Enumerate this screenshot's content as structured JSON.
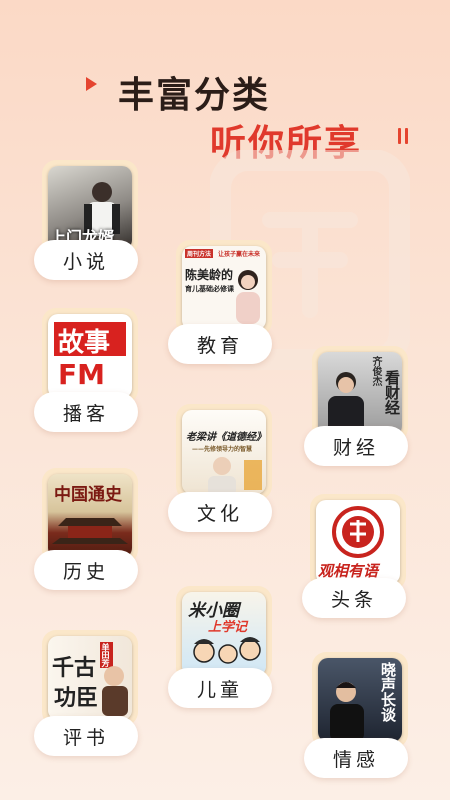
{
  "header": {
    "line1": "丰富分类",
    "line2": "听你所享"
  },
  "categories": [
    {
      "label": "小说",
      "cover_title": "上门龙婿",
      "icon": "novel-cover"
    },
    {
      "label": "教育",
      "cover_title": "陈美龄的育儿基础必修课",
      "cover_line1": "陈美龄的",
      "cover_line2": "育儿基础必修课",
      "cover_tag1": "周刊方法",
      "cover_tag2": "让孩子赢在未来",
      "icon": "education-cover"
    },
    {
      "label": "播客",
      "cover_title": "故事FM",
      "cover_line1": "故事",
      "cover_line2": "FM",
      "icon": "podcast-cover"
    },
    {
      "label": "财经",
      "cover_title": "齐俊杰看财经",
      "cover_line1": "齐俊杰",
      "cover_line2": "看财经",
      "icon": "finance-cover"
    },
    {
      "label": "文化",
      "cover_title": "老梁讲《道德经》",
      "cover_subtitle": "——先修领导力的智慧",
      "icon": "culture-cover"
    },
    {
      "label": "历史",
      "cover_title": "中国通史",
      "icon": "history-cover"
    },
    {
      "label": "头条",
      "cover_title": "观相有语",
      "icon": "headline-cover"
    },
    {
      "label": "儿童",
      "cover_title": "米小圈上学记",
      "cover_line1": "米小圈",
      "cover_line2": "上学记",
      "icon": "children-cover"
    },
    {
      "label": "评书",
      "cover_title": "千古功臣",
      "cover_line1": "千古",
      "cover_line2": "功臣",
      "cover_tag1": "单田芳",
      "icon": "storytelling-cover"
    },
    {
      "label": "情感",
      "cover_title": "晓声长谈",
      "icon": "emotion-cover"
    }
  ],
  "colors": {
    "accent_red": "#e0392c",
    "title_dark": "#2b1d18",
    "tile_bg": "#fbe7c9",
    "pill_bg": "#ffffff"
  }
}
